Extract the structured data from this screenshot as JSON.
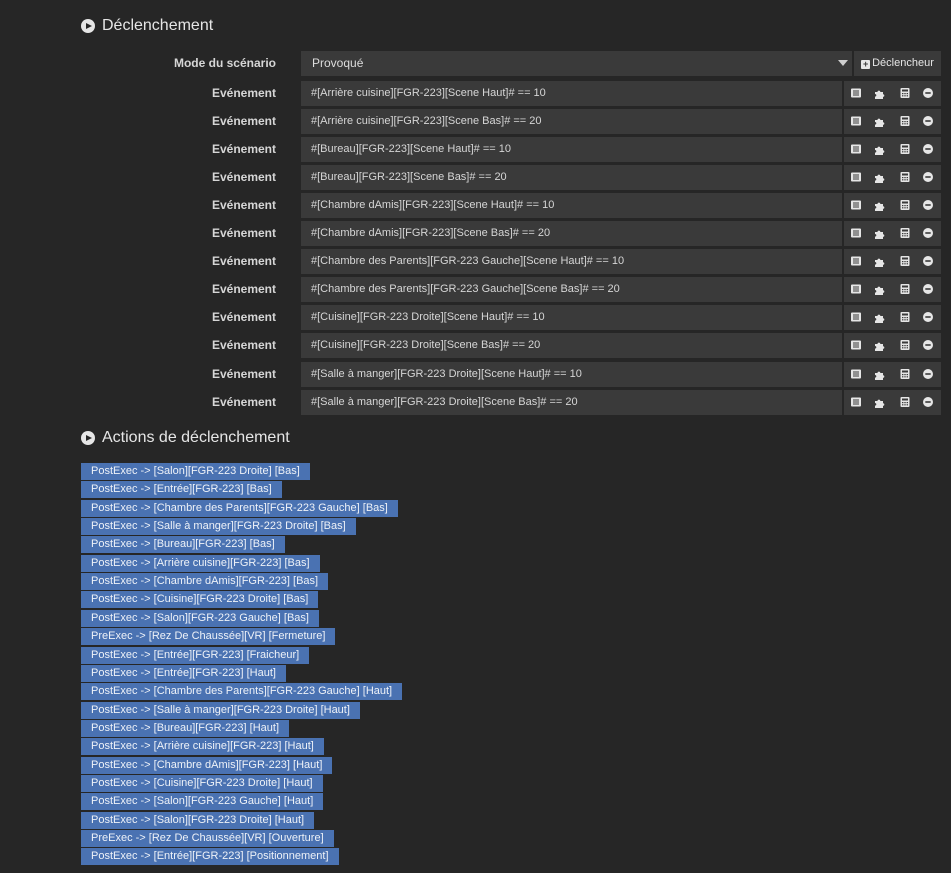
{
  "triggers": {
    "title": "Déclenchement",
    "mode_label": "Mode du scénario",
    "mode_value": "Provoqué",
    "add_trigger_label": "Déclencheur",
    "event_label": "Evénement",
    "events": [
      "#[Arrière cuisine][FGR-223][Scene Haut]# == 10",
      "#[Arrière cuisine][FGR-223][Scene Bas]# == 20",
      "#[Bureau][FGR-223][Scene Haut]# == 10",
      "#[Bureau][FGR-223][Scene Bas]# == 20",
      "#[Chambre dAmis][FGR-223][Scene Haut]# == 10",
      "#[Chambre dAmis][FGR-223][Scene Bas]# == 20",
      "#[Chambre des Parents][FGR-223 Gauche][Scene Haut]# == 10",
      "#[Chambre des Parents][FGR-223 Gauche][Scene Bas]# == 20",
      "#[Cuisine][FGR-223 Droite][Scene Haut]# == 10",
      "#[Cuisine][FGR-223 Droite][Scene Bas]# == 20",
      "#[Salle à manger][FGR-223 Droite][Scene Haut]# == 10",
      "#[Salle à manger][FGR-223 Droite][Scene Bas]# == 20"
    ],
    "event_icons": [
      "list-icon",
      "puzzle-icon",
      "calculator-icon",
      "remove-icon"
    ]
  },
  "actions": {
    "title": "Actions de déclenchement",
    "items": [
      "PostExec -> [Salon][FGR-223 Droite] [Bas]",
      "PostExec -> [Entrée][FGR-223] [Bas]",
      "PostExec -> [Chambre des Parents][FGR-223 Gauche] [Bas]",
      "PostExec -> [Salle à manger][FGR-223 Droite] [Bas]",
      "PostExec -> [Bureau][FGR-223] [Bas]",
      "PostExec -> [Arrière cuisine][FGR-223] [Bas]",
      "PostExec -> [Chambre dAmis][FGR-223] [Bas]",
      "PostExec -> [Cuisine][FGR-223 Droite] [Bas]",
      "PostExec -> [Salon][FGR-223 Gauche] [Bas]",
      "PreExec -> [Rez De Chaussée][VR] [Fermeture]",
      "PostExec -> [Entrée][FGR-223] [Fraicheur]",
      "PostExec -> [Entrée][FGR-223] [Haut]",
      "PostExec -> [Chambre des Parents][FGR-223 Gauche] [Haut]",
      "PostExec -> [Salle à manger][FGR-223 Droite] [Haut]",
      "PostExec -> [Bureau][FGR-223] [Haut]",
      "PostExec -> [Arrière cuisine][FGR-223] [Haut]",
      "PostExec -> [Chambre dAmis][FGR-223] [Haut]",
      "PostExec -> [Cuisine][FGR-223 Droite] [Haut]",
      "PostExec -> [Salon][FGR-223 Gauche] [Haut]",
      "PostExec -> [Salon][FGR-223 Droite] [Haut]",
      "PreExec -> [Rez De Chaussée][VR] [Ouverture]",
      "PostExec -> [Entrée][FGR-223] [Positionnement]"
    ]
  },
  "colors": {
    "background": "#262626",
    "field": "#3a3a3a",
    "action_tag": "#4a72b2"
  }
}
